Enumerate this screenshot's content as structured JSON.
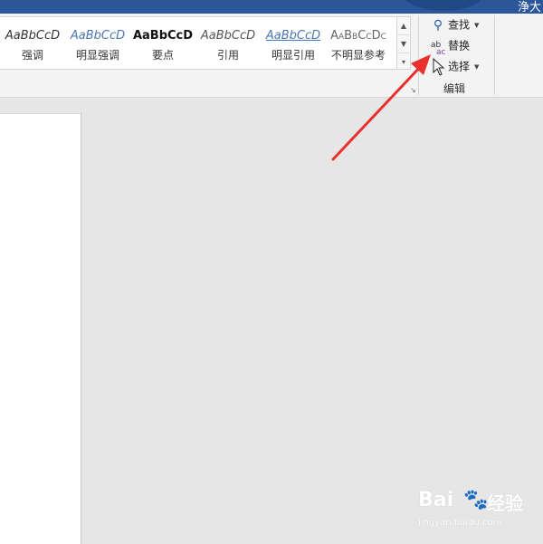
{
  "titlebar": {
    "text": "浄大"
  },
  "styles_gallery": {
    "items": [
      {
        "preview": "AaBbCcD",
        "name": "强调",
        "preview_color": "#333333"
      },
      {
        "preview": "AaBbCcD",
        "name": "明显强调",
        "preview_color": "#4a78b5"
      },
      {
        "preview": "AaBbCcD",
        "name": "要点",
        "preview_color": "#111111"
      },
      {
        "preview": "AaBbCcD",
        "name": "引用",
        "preview_color": "#555555"
      },
      {
        "preview": "AaBbCcD",
        "name": "明显引用",
        "preview_color": "#4a78b5"
      },
      {
        "preview": "AaBbCcDc",
        "name": "不明显参考",
        "preview_color": "#666666"
      }
    ],
    "scroll": {
      "up": "▲",
      "down": "▼",
      "more": "▾"
    },
    "launcher": "↘"
  },
  "editing_group": {
    "find": {
      "label": "查找",
      "icon": "search-icon",
      "glyph": "⚲",
      "drop": "▼"
    },
    "replace": {
      "label": "替换",
      "icon": "replace-icon",
      "ab_top": "ab",
      "ab_bottom": "ac"
    },
    "select": {
      "label": "选择",
      "icon": "select-cursor-icon",
      "drop": "▼"
    },
    "group_label": "编辑"
  },
  "annotation": {
    "color": "#e8302c"
  },
  "watermark": {
    "brand": "Bai",
    "paw": "🐾",
    "brand_cn": "经验",
    "url": "jingyan.baidu.com"
  }
}
